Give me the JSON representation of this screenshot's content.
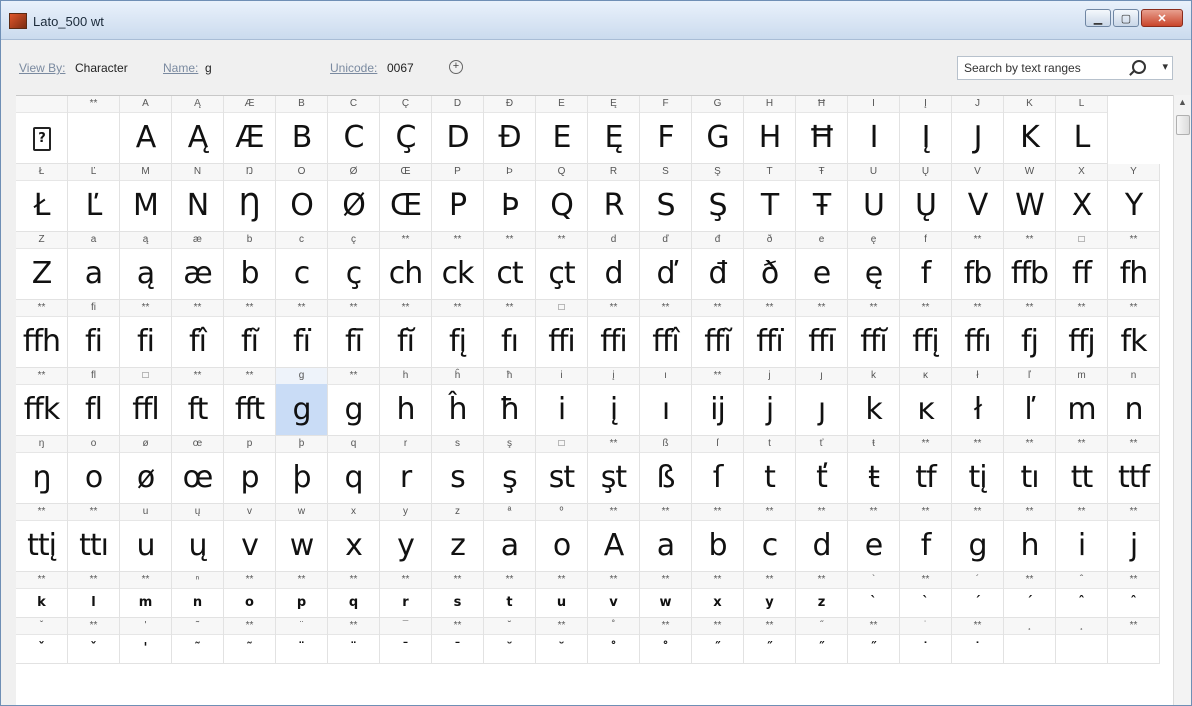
{
  "window": {
    "title": "Lato_500 wt"
  },
  "toolbar": {
    "view_by_label": "View By:",
    "view_by_value": "Character",
    "name_label": "Name:",
    "name_value": "g",
    "unicode_label": "Unicode:",
    "unicode_value": "0067",
    "search_placeholder": "Search by text ranges"
  },
  "grid": {
    "selected": "g",
    "rows": [
      {
        "size": "big",
        "cells": [
          [
            "",
            "?"
          ],
          [
            "**",
            ""
          ],
          [
            "A",
            "A"
          ],
          [
            "Ą",
            "Ą"
          ],
          [
            "Æ",
            "Æ"
          ],
          [
            "B",
            "B"
          ],
          [
            "C",
            "C"
          ],
          [
            "Ç",
            "Ç"
          ],
          [
            "D",
            "D"
          ],
          [
            "Đ",
            "Đ"
          ],
          [
            "E",
            "E"
          ],
          [
            "Ę",
            "Ę"
          ],
          [
            "F",
            "F"
          ],
          [
            "G",
            "G"
          ],
          [
            "H",
            "H"
          ],
          [
            "Ħ",
            "Ħ"
          ],
          [
            "I",
            "I"
          ],
          [
            "Į",
            "Į"
          ],
          [
            "J",
            "J"
          ],
          [
            "K",
            "K"
          ],
          [
            "L",
            "L"
          ]
        ]
      },
      {
        "size": "big",
        "cells": [
          [
            "Ł",
            "Ł"
          ],
          [
            "Ľ",
            "Ľ"
          ],
          [
            "M",
            "M"
          ],
          [
            "N",
            "N"
          ],
          [
            "Ŋ",
            "Ŋ"
          ],
          [
            "O",
            "O"
          ],
          [
            "Ø",
            "Ø"
          ],
          [
            "Œ",
            "Œ"
          ],
          [
            "P",
            "P"
          ],
          [
            "Þ",
            "Þ"
          ],
          [
            "Q",
            "Q"
          ],
          [
            "R",
            "R"
          ],
          [
            "S",
            "S"
          ],
          [
            "Ş",
            "Ş"
          ],
          [
            "T",
            "T"
          ],
          [
            "Ŧ",
            "Ŧ"
          ],
          [
            "U",
            "U"
          ],
          [
            "Ų",
            "Ų"
          ],
          [
            "V",
            "V"
          ],
          [
            "W",
            "W"
          ],
          [
            "X",
            "X"
          ],
          [
            "Y",
            "Y"
          ]
        ]
      },
      {
        "size": "big",
        "cells": [
          [
            "Z",
            "Z"
          ],
          [
            "a",
            "a"
          ],
          [
            "ą",
            "ą"
          ],
          [
            "æ",
            "æ"
          ],
          [
            "b",
            "b"
          ],
          [
            "c",
            "c"
          ],
          [
            "ç",
            "ç"
          ],
          [
            "**",
            "ch"
          ],
          [
            "**",
            "ck"
          ],
          [
            "**",
            "ct"
          ],
          [
            "**",
            "çt"
          ],
          [
            "d",
            "d"
          ],
          [
            "ď",
            "ď"
          ],
          [
            "đ",
            "đ"
          ],
          [
            "ð",
            "ð"
          ],
          [
            "e",
            "e"
          ],
          [
            "ę",
            "ę"
          ],
          [
            "f",
            "f"
          ],
          [
            "**",
            "fb"
          ],
          [
            "**",
            "ffb"
          ],
          [
            "□",
            "ff"
          ],
          [
            "**",
            "fh"
          ]
        ]
      },
      {
        "size": "big",
        "cells": [
          [
            "**",
            "ffh"
          ],
          [
            "fi",
            "fi"
          ],
          [
            "**",
            "fi"
          ],
          [
            "**",
            "fî"
          ],
          [
            "**",
            "fĩ"
          ],
          [
            "**",
            "fï"
          ],
          [
            "**",
            "fī"
          ],
          [
            "**",
            "fĭ"
          ],
          [
            "**",
            "fį"
          ],
          [
            "**",
            "fı"
          ],
          [
            "□",
            "ffi"
          ],
          [
            "**",
            "ffi"
          ],
          [
            "**",
            "ffî"
          ],
          [
            "**",
            "ffĩ"
          ],
          [
            "**",
            "ffï"
          ],
          [
            "**",
            "ffī"
          ],
          [
            "**",
            "ffĭ"
          ],
          [
            "**",
            "ffį"
          ],
          [
            "**",
            "ffı"
          ],
          [
            "**",
            "fj"
          ],
          [
            "**",
            "ffj"
          ],
          [
            "**",
            "fk"
          ]
        ]
      },
      {
        "size": "big",
        "cells": [
          [
            "**",
            "ffk"
          ],
          [
            "fl",
            "fl"
          ],
          [
            "□",
            "ffl"
          ],
          [
            "**",
            "ft"
          ],
          [
            "**",
            "fft"
          ],
          [
            "g",
            "g"
          ],
          [
            "**",
            "g"
          ],
          [
            "h",
            "h"
          ],
          [
            "ĥ",
            "ĥ"
          ],
          [
            "ħ",
            "ħ"
          ],
          [
            "i",
            "i"
          ],
          [
            "į",
            "į"
          ],
          [
            "ı",
            "ı"
          ],
          [
            "**",
            "ij"
          ],
          [
            "j",
            "j"
          ],
          [
            "ȷ",
            "ȷ"
          ],
          [
            "k",
            "k"
          ],
          [
            "ĸ",
            "ĸ"
          ],
          [
            "ł",
            "ł"
          ],
          [
            "ľ",
            "ľ"
          ],
          [
            "m",
            "m"
          ],
          [
            "n",
            "n"
          ]
        ]
      },
      {
        "size": "big",
        "cells": [
          [
            "ŋ",
            "ŋ"
          ],
          [
            "o",
            "o"
          ],
          [
            "ø",
            "ø"
          ],
          [
            "œ",
            "œ"
          ],
          [
            "p",
            "p"
          ],
          [
            "þ",
            "þ"
          ],
          [
            "q",
            "q"
          ],
          [
            "r",
            "r"
          ],
          [
            "s",
            "s"
          ],
          [
            "ş",
            "ş"
          ],
          [
            "□",
            "st"
          ],
          [
            "**",
            "şt"
          ],
          [
            "ß",
            "ß"
          ],
          [
            "ſ",
            "ſ"
          ],
          [
            "t",
            "t"
          ],
          [
            "ť",
            "ť"
          ],
          [
            "ŧ",
            "ŧ"
          ],
          [
            "**",
            "tf"
          ],
          [
            "**",
            "tį"
          ],
          [
            "**",
            "tı"
          ],
          [
            "**",
            "tt"
          ],
          [
            "**",
            "ttf"
          ]
        ]
      },
      {
        "size": "big",
        "cells": [
          [
            "**",
            "ttį"
          ],
          [
            "**",
            "ttı"
          ],
          [
            "u",
            "u"
          ],
          [
            "ų",
            "ų"
          ],
          [
            "v",
            "v"
          ],
          [
            "w",
            "w"
          ],
          [
            "x",
            "x"
          ],
          [
            "y",
            "y"
          ],
          [
            "z",
            "z"
          ],
          [
            "ª",
            "a"
          ],
          [
            "º",
            "o"
          ],
          [
            "**",
            "A"
          ],
          [
            "**",
            "a"
          ],
          [
            "**",
            "b"
          ],
          [
            "**",
            "c"
          ],
          [
            "**",
            "d"
          ],
          [
            "**",
            "e"
          ],
          [
            "**",
            "f"
          ],
          [
            "**",
            "g"
          ],
          [
            "**",
            "h"
          ],
          [
            "**",
            "i"
          ],
          [
            "**",
            "j"
          ]
        ]
      },
      {
        "size": "small",
        "cells": [
          [
            "**",
            "k"
          ],
          [
            "**",
            "l"
          ],
          [
            "**",
            "m"
          ],
          [
            "ⁿ",
            "n"
          ],
          [
            "**",
            "o"
          ],
          [
            "**",
            "p"
          ],
          [
            "**",
            "q"
          ],
          [
            "**",
            "r"
          ],
          [
            "**",
            "s"
          ],
          [
            "**",
            "t"
          ],
          [
            "**",
            "u"
          ],
          [
            "**",
            "v"
          ],
          [
            "**",
            "w"
          ],
          [
            "**",
            "x"
          ],
          [
            "**",
            "y"
          ],
          [
            "**",
            "z"
          ],
          [
            "`",
            "`"
          ],
          [
            "**",
            "`"
          ],
          [
            "´",
            "´"
          ],
          [
            "**",
            "´"
          ],
          [
            "ˆ",
            "ˆ"
          ],
          [
            "**",
            "ˆ"
          ]
        ]
      },
      {
        "size": "small",
        "cells": [
          [
            "ˇ",
            "ˇ"
          ],
          [
            "**",
            "ˇ"
          ],
          [
            "'",
            "'"
          ],
          [
            "˜",
            "˜"
          ],
          [
            "**",
            "˜"
          ],
          [
            "¨",
            "¨"
          ],
          [
            "**",
            "¨"
          ],
          [
            "¯",
            "¯"
          ],
          [
            "**",
            "¯"
          ],
          [
            "˘",
            "˘"
          ],
          [
            "**",
            "˘"
          ],
          [
            "˚",
            "˚"
          ],
          [
            "**",
            "˚"
          ],
          [
            "**",
            "˝"
          ],
          [
            "**",
            "˝"
          ],
          [
            "˝",
            "˝"
          ],
          [
            "**",
            "˝"
          ],
          [
            "˙",
            "˙"
          ],
          [
            "**",
            "˙"
          ],
          [
            "¸",
            ""
          ],
          [
            "¸",
            ""
          ],
          [
            "**",
            ""
          ]
        ]
      }
    ]
  }
}
